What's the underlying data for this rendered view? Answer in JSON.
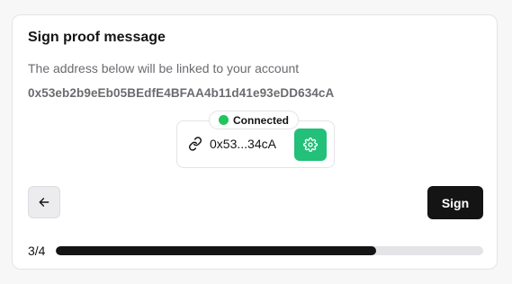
{
  "dialog": {
    "title": "Sign proof message",
    "description": "The address below will be linked to your account",
    "address": "0x53eb2b9eEb05BEdfE4BFAA4b11d41e93eDD634cA"
  },
  "wallet": {
    "status_label": "Connected",
    "status_color": "#22c55e",
    "short_address": "0x53...34cA",
    "link_icon": "link-icon",
    "settings_icon": "gear-icon",
    "settings_color": "#22c078"
  },
  "actions": {
    "back_icon": "arrow-left-icon",
    "sign_label": "Sign"
  },
  "progress": {
    "step_label": "3/4",
    "fraction": 0.75
  }
}
